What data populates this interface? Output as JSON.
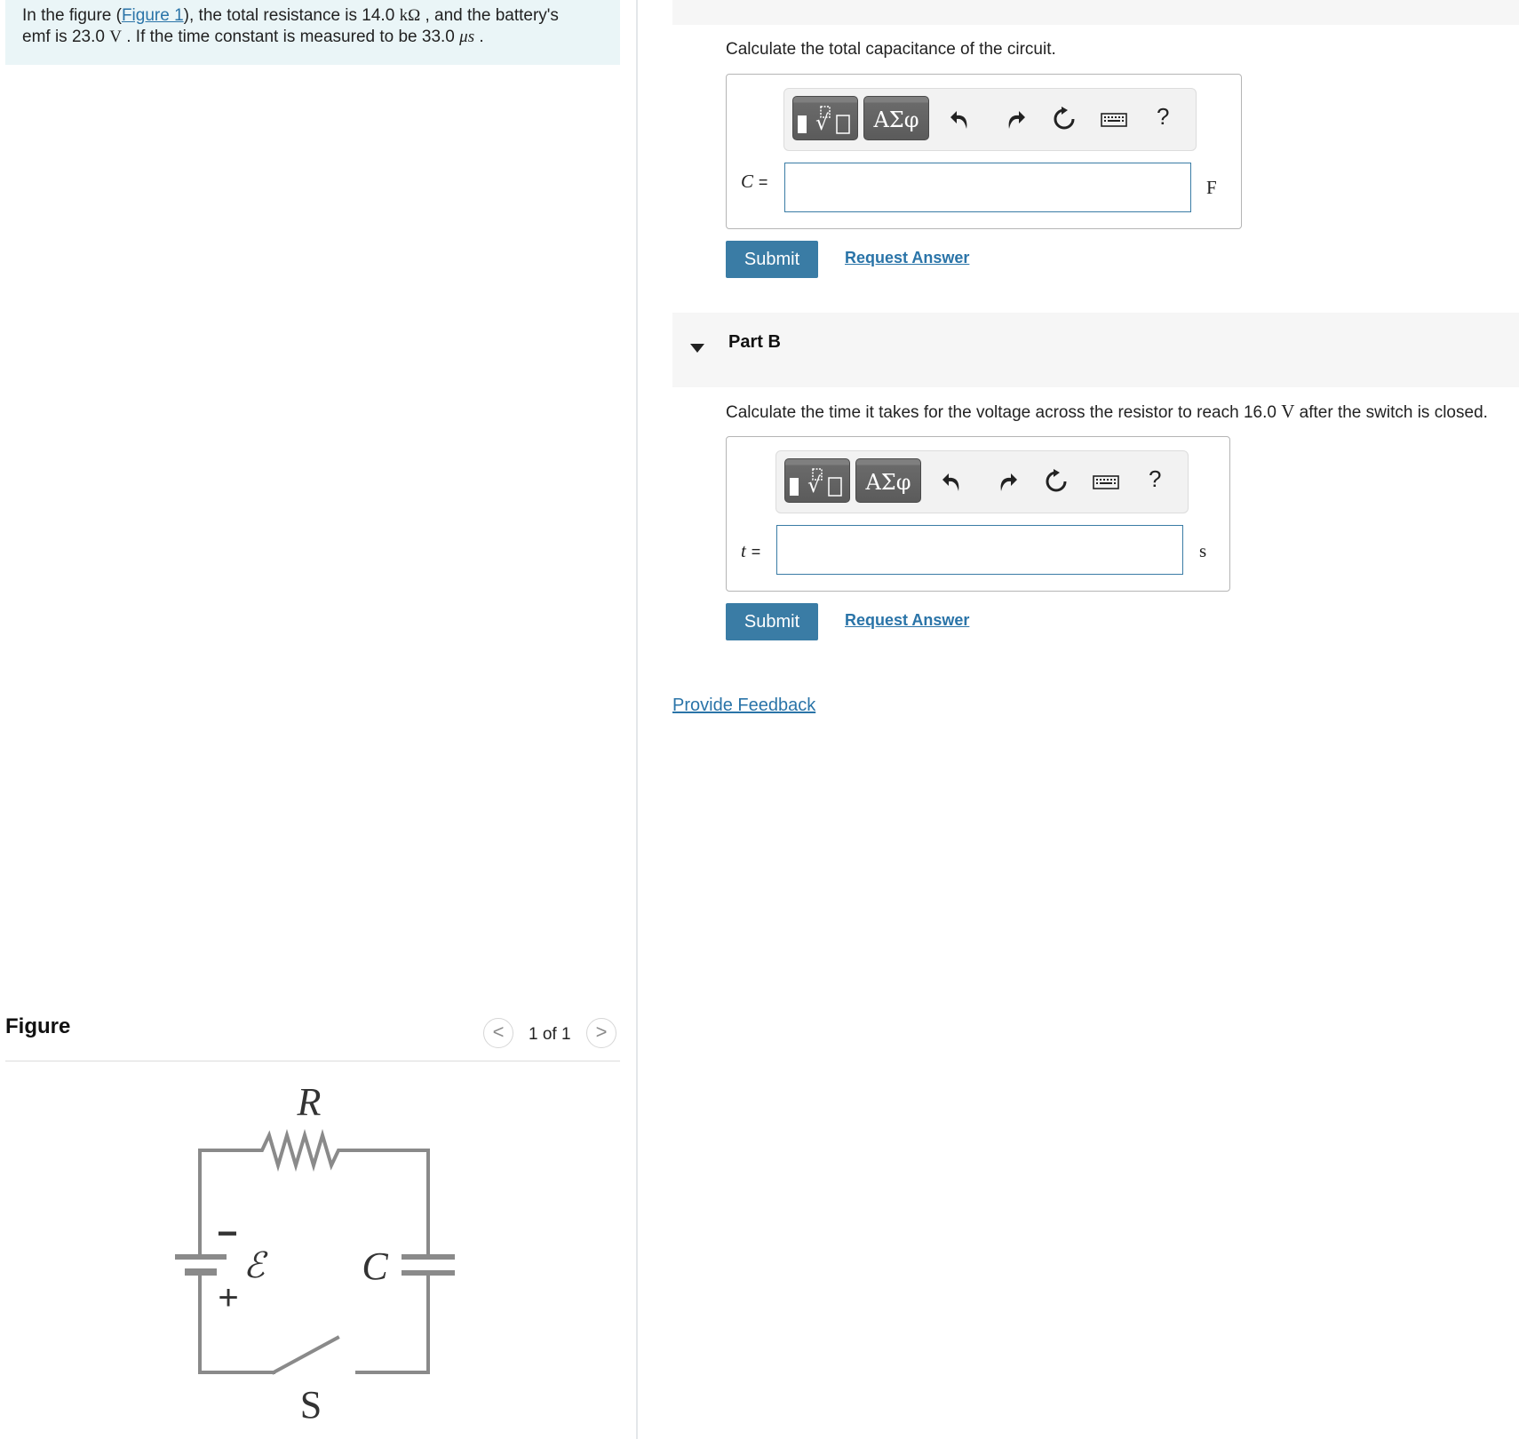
{
  "problem": {
    "prefix": "In the figure (",
    "figure_link": "Figure 1",
    "mid1": "), the total resistance is 14.0 ",
    "unit_kohm": "kΩ",
    "mid2": " , and the battery's",
    "line2a": "emf is 23.0 ",
    "unit_v": "V",
    "line2b": " . If the time constant is measured to be 33.0 ",
    "unit_us": "μs",
    "line2c": " ."
  },
  "part_a": {
    "prompt": "Calculate the total capacitance of the circuit.",
    "variable": "C",
    "equals": "=",
    "unit": "F",
    "input_value": "",
    "submit_label": "Submit",
    "request_label": "Request Answer"
  },
  "part_b": {
    "title": "Part B",
    "prompt_a": "Calculate the time it takes for the voltage across the resistor to reach 16.0 ",
    "prompt_unit": "V",
    "prompt_b": " after the switch is closed.",
    "variable": "t",
    "equals": "=",
    "unit": "s",
    "input_value": "",
    "submit_label": "Submit",
    "request_label": "Request Answer"
  },
  "toolbar": {
    "greek_label": "ΑΣφ",
    "help_label": "?",
    "icons": [
      "templates-icon",
      "greek-symbols",
      "undo-icon",
      "redo-icon",
      "reset-icon",
      "keyboard-icon",
      "help-icon"
    ]
  },
  "feedback_label": "Provide Feedback",
  "figure": {
    "heading": "Figure",
    "counter": "1 of 1",
    "prev": "<",
    "next": ">",
    "labels": {
      "R": "R",
      "emf": "ℰ",
      "C": "C",
      "S": "S",
      "minus": "−",
      "plus": "+"
    }
  },
  "colors": {
    "accent": "#3a7ca5",
    "link": "#2a74a8",
    "problem_bg": "#eaf5f7",
    "wire": "#8a8a8a"
  }
}
